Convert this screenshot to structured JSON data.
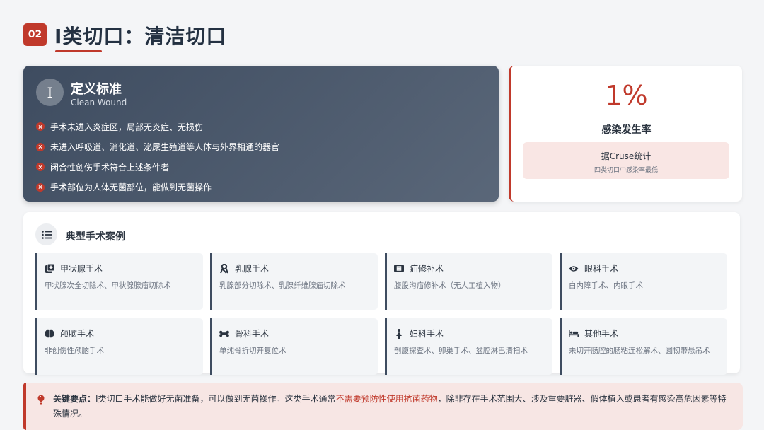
{
  "header": {
    "badge": "02",
    "title": "I类切口：清洁切口"
  },
  "definition": {
    "roman": "I",
    "title": "定义标准",
    "subtitle": "Clean Wound",
    "items": [
      "手术未进入炎症区，局部无炎症、无损伤",
      "未进入呼吸道、消化道、泌尿生殖道等人体与外界相通的器官",
      "闭合性创伤手术符合上述条件者",
      "手术部位为人体无菌部位，能做到无菌操作"
    ]
  },
  "rate": {
    "value": "1%",
    "label": "感染发生率",
    "source": "据Cruse统计",
    "note": "四类切口中感染率最低"
  },
  "cases": {
    "title": "典型手术案例",
    "items": [
      {
        "icon": "thyroid-plus-icon",
        "name": "甲状腺手术",
        "desc": "甲状腺次全切除术、甲状腺腺瘤切除术"
      },
      {
        "icon": "ribbon-icon",
        "name": "乳腺手术",
        "desc": "乳腺部分切除术、乳腺纤维腺瘤切除术"
      },
      {
        "icon": "bandage-icon",
        "name": "疝修补术",
        "desc": "腹股沟疝修补术（无人工植入物）"
      },
      {
        "icon": "eye-icon",
        "name": "眼科手术",
        "desc": "白内障手术、内眼手术"
      },
      {
        "icon": "brain-icon",
        "name": "颅脑手术",
        "desc": "非创伤性颅脑手术"
      },
      {
        "icon": "bone-icon",
        "name": "骨科手术",
        "desc": "单纯骨折切开复位术"
      },
      {
        "icon": "female-icon",
        "name": "妇科手术",
        "desc": "剖腹探查术、卵巢手术、盆腔淋巴清扫术"
      },
      {
        "icon": "bed-icon",
        "name": "其他手术",
        "desc": "未切开肠腔的肠粘连松解术、圆韧带悬吊术"
      }
    ]
  },
  "key_point": {
    "label": "关键要点：",
    "text_before": "I类切口手术能做好无菌准备，可以做到无菌操作。这类手术通常",
    "highlight": "不需要预防性使用抗菌药物",
    "text_after": "，除非存在手术范围大、涉及重要脏器、假体植入或患者有感染高危因素等特殊情况。"
  },
  "colors": {
    "accent": "#c0392b",
    "dark": "#3e4c60"
  }
}
